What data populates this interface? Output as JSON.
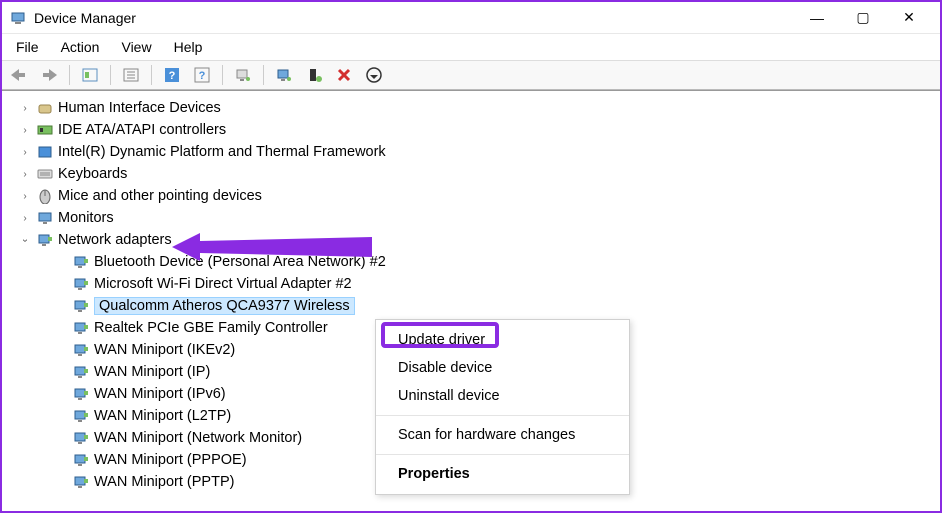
{
  "window": {
    "title": "Device Manager",
    "minimize": "—",
    "maximize": "▢",
    "close": "✕"
  },
  "menu": {
    "file": "File",
    "action": "Action",
    "view": "View",
    "help": "Help"
  },
  "tree": {
    "cat_hid": "Human Interface Devices",
    "cat_ide": "IDE ATA/ATAPI controllers",
    "cat_intel": "Intel(R) Dynamic Platform and Thermal Framework",
    "cat_keyboards": "Keyboards",
    "cat_mice": "Mice and other pointing devices",
    "cat_monitors": "Monitors",
    "cat_network": "Network adapters",
    "net_bt": "Bluetooth Device (Personal Area Network) #2",
    "net_wifi_direct": "Microsoft Wi-Fi Direct Virtual Adapter #2",
    "net_qca": "Qualcomm Atheros QCA9377 Wireless",
    "net_realtek": "Realtek PCIe GBE Family Controller",
    "net_wan_ikev2": "WAN Miniport (IKEv2)",
    "net_wan_ip": "WAN Miniport (IP)",
    "net_wan_ipv6": "WAN Miniport (IPv6)",
    "net_wan_l2tp": "WAN Miniport (L2TP)",
    "net_wan_netmon": "WAN Miniport (Network Monitor)",
    "net_wan_pppoe": "WAN Miniport (PPPOE)",
    "net_wan_pptp": "WAN Miniport (PPTP)"
  },
  "context_menu": {
    "update_driver": "Update driver",
    "disable_device": "Disable device",
    "uninstall_device": "Uninstall device",
    "scan": "Scan for hardware changes",
    "properties": "Properties"
  },
  "annotation": {
    "arrow_target": "Network adapters",
    "highlight_target": "Update driver"
  }
}
